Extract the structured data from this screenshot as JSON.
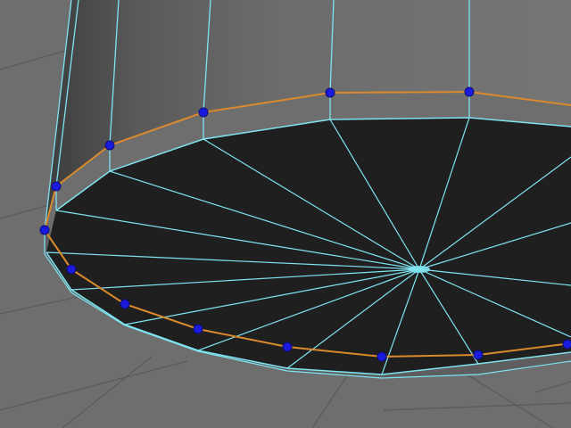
{
  "app": {
    "view": "3d-viewport",
    "shading": "smooth-shaded-with-wireframe"
  },
  "scene": {
    "object": "cylinder",
    "selected_component": "edge-loop",
    "selected_vertex_count": 14
  },
  "colors": {
    "background": "#6e6e6e",
    "grid": "#5a5a5a",
    "cap_face": "#1f1f1f",
    "wireframe": "#7fe3f0",
    "edge_loop": "#d98a2c",
    "vertex": "#1a1adc"
  },
  "icons": {
    "vertex_marker": "vertex-dot-icon"
  }
}
